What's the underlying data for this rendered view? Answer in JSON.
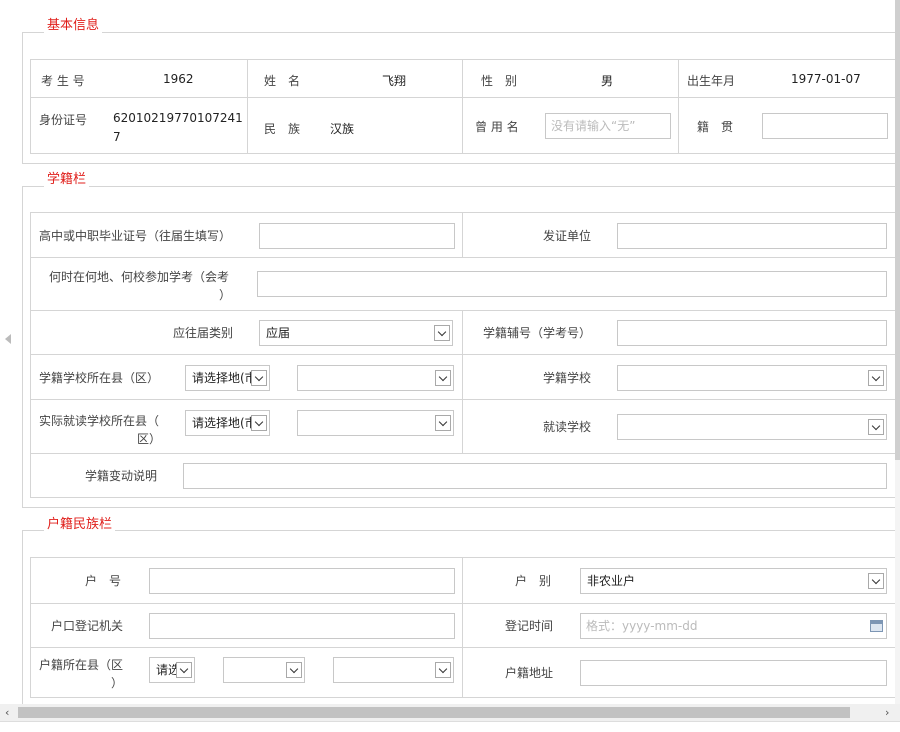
{
  "sections": {
    "basic": "基本信息",
    "school": "学籍栏",
    "household": "户籍民族栏"
  },
  "basic": {
    "exam_no_label": "考 生 号",
    "exam_no": "1962",
    "name_label": "姓　名",
    "name": "飞翔",
    "gender_label": "性　别",
    "gender": "男",
    "birth_label": "出生年月",
    "birth": "1977-01-07",
    "id_label": "身份证号",
    "id_line1": "62010219770107241",
    "id_line2": "7",
    "ethnic_label": "民　族",
    "ethnic": "汉族",
    "former_name_label": "曾 用 名",
    "former_name_placeholder": "没有请输入“无”",
    "native_label": "籍　贯",
    "native_value": ""
  },
  "school": {
    "cert_label": "高中或中职毕业证号（往届生填写）",
    "issuer_label": "发证单位",
    "exam_place_label_1": "何时在何地、何校参加学考（会考",
    "exam_place_label_2": "）",
    "category_label": "应往届类别",
    "category_value": "应届",
    "school_reg_label": "学籍辅号（学考号）",
    "school_county_label": "学籍学校所在县（区）",
    "select_area_placeholder": "请选择地(市",
    "school_label": "学籍学校",
    "actual_county_label_1": "实际就读学校所在县（",
    "actual_county_label_2": "区）",
    "actual_school_label": "就读学校",
    "change_label": "学籍变动说明"
  },
  "household": {
    "hukou_no_label": "户　号",
    "hukou_type_label": "户　别",
    "hukou_type_value": "非农业户",
    "office_label": "户口登记机关",
    "reg_time_label": "登记时间",
    "reg_time_placeholder": "格式：yyyy-mm-dd",
    "county_label_1": "户籍所在县（区",
    "county_label_2": "）",
    "county_select_short": "请选",
    "address_label": "户籍地址"
  }
}
